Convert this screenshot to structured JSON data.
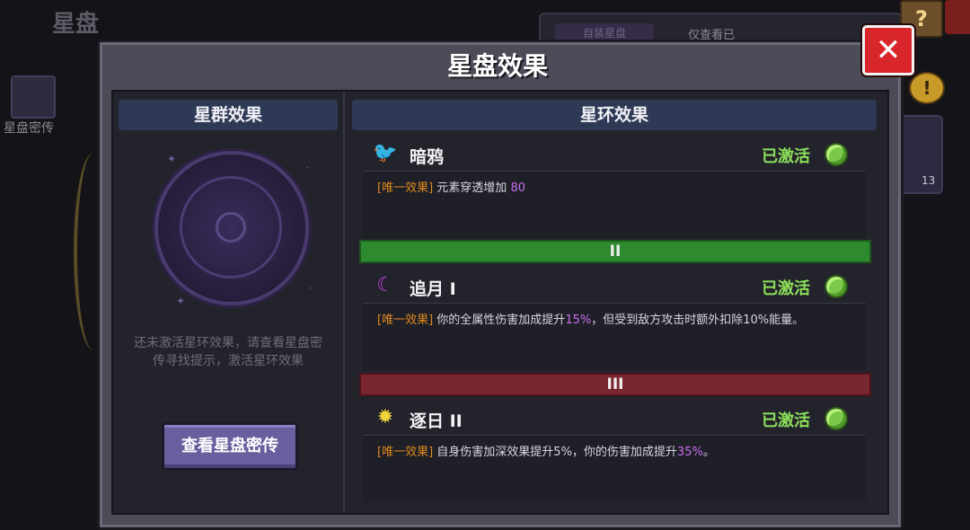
{
  "background": {
    "title": "星盘",
    "side_label": "星盘密传",
    "help_icon": "?",
    "coin_icon": "!",
    "top_tab": "自装星盘",
    "top_label": "仅查看已",
    "item_count": "13"
  },
  "dialog": {
    "title": "星盘效果",
    "close_symbol": "✕",
    "left": {
      "header": "星群效果",
      "hint_line1": "还未激活星环效果，请查看星盘密",
      "hint_line2": "传寻找提示，激活星环效果",
      "button": "查看星盘密传"
    },
    "right": {
      "header": "星环效果",
      "effects": [
        {
          "name": "暗鸦",
          "icon": "crow-icon",
          "status": "已激活",
          "tag": "[唯一效果]",
          "desc_parts": [
            "元素穿透增加 ",
            "80",
            ""
          ]
        },
        {
          "name": "追月 I",
          "icon": "crescent-moon-icon",
          "status": "已激活",
          "tag": "[唯一效果]",
          "desc_parts": [
            "你的全属性伤害加成提升",
            "15%",
            "，但受到敌方攻击时额外扣除10%能量。"
          ]
        },
        {
          "name": "逐日 II",
          "icon": "sun-icon",
          "status": "已激活",
          "tag": "[唯一效果]",
          "desc_parts": [
            "自身伤害加深效果提升5%，你的伤害加成提升",
            "35%",
            "。"
          ]
        }
      ],
      "tiers": [
        "II",
        "III"
      ]
    }
  },
  "colors": {
    "accent_purple": "#c86ef0",
    "tag_orange": "#e0891f",
    "status_green": "#8ce05a",
    "close_red": "#d8262a",
    "tier2_green": "#2e8a2e",
    "tier3_red": "#7a2630"
  }
}
